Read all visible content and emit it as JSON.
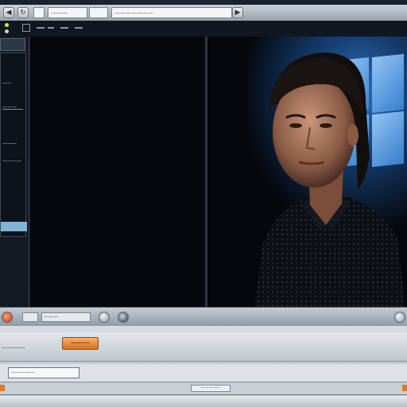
{
  "window": {
    "address_text": "———————",
    "tab_text": "———"
  },
  "left_panel": {
    "lines": [
      "——",
      "———",
      "———",
      "————"
    ]
  },
  "status": {
    "field_text": "———"
  },
  "lower": {
    "left_label": "—————",
    "action_button": "————",
    "input_value": "—————",
    "tag_text": "—————"
  },
  "colors": {
    "accent_orange": "#e07a1e",
    "windows_blue": "#3a86d8",
    "selection": "#7fb4d6"
  }
}
